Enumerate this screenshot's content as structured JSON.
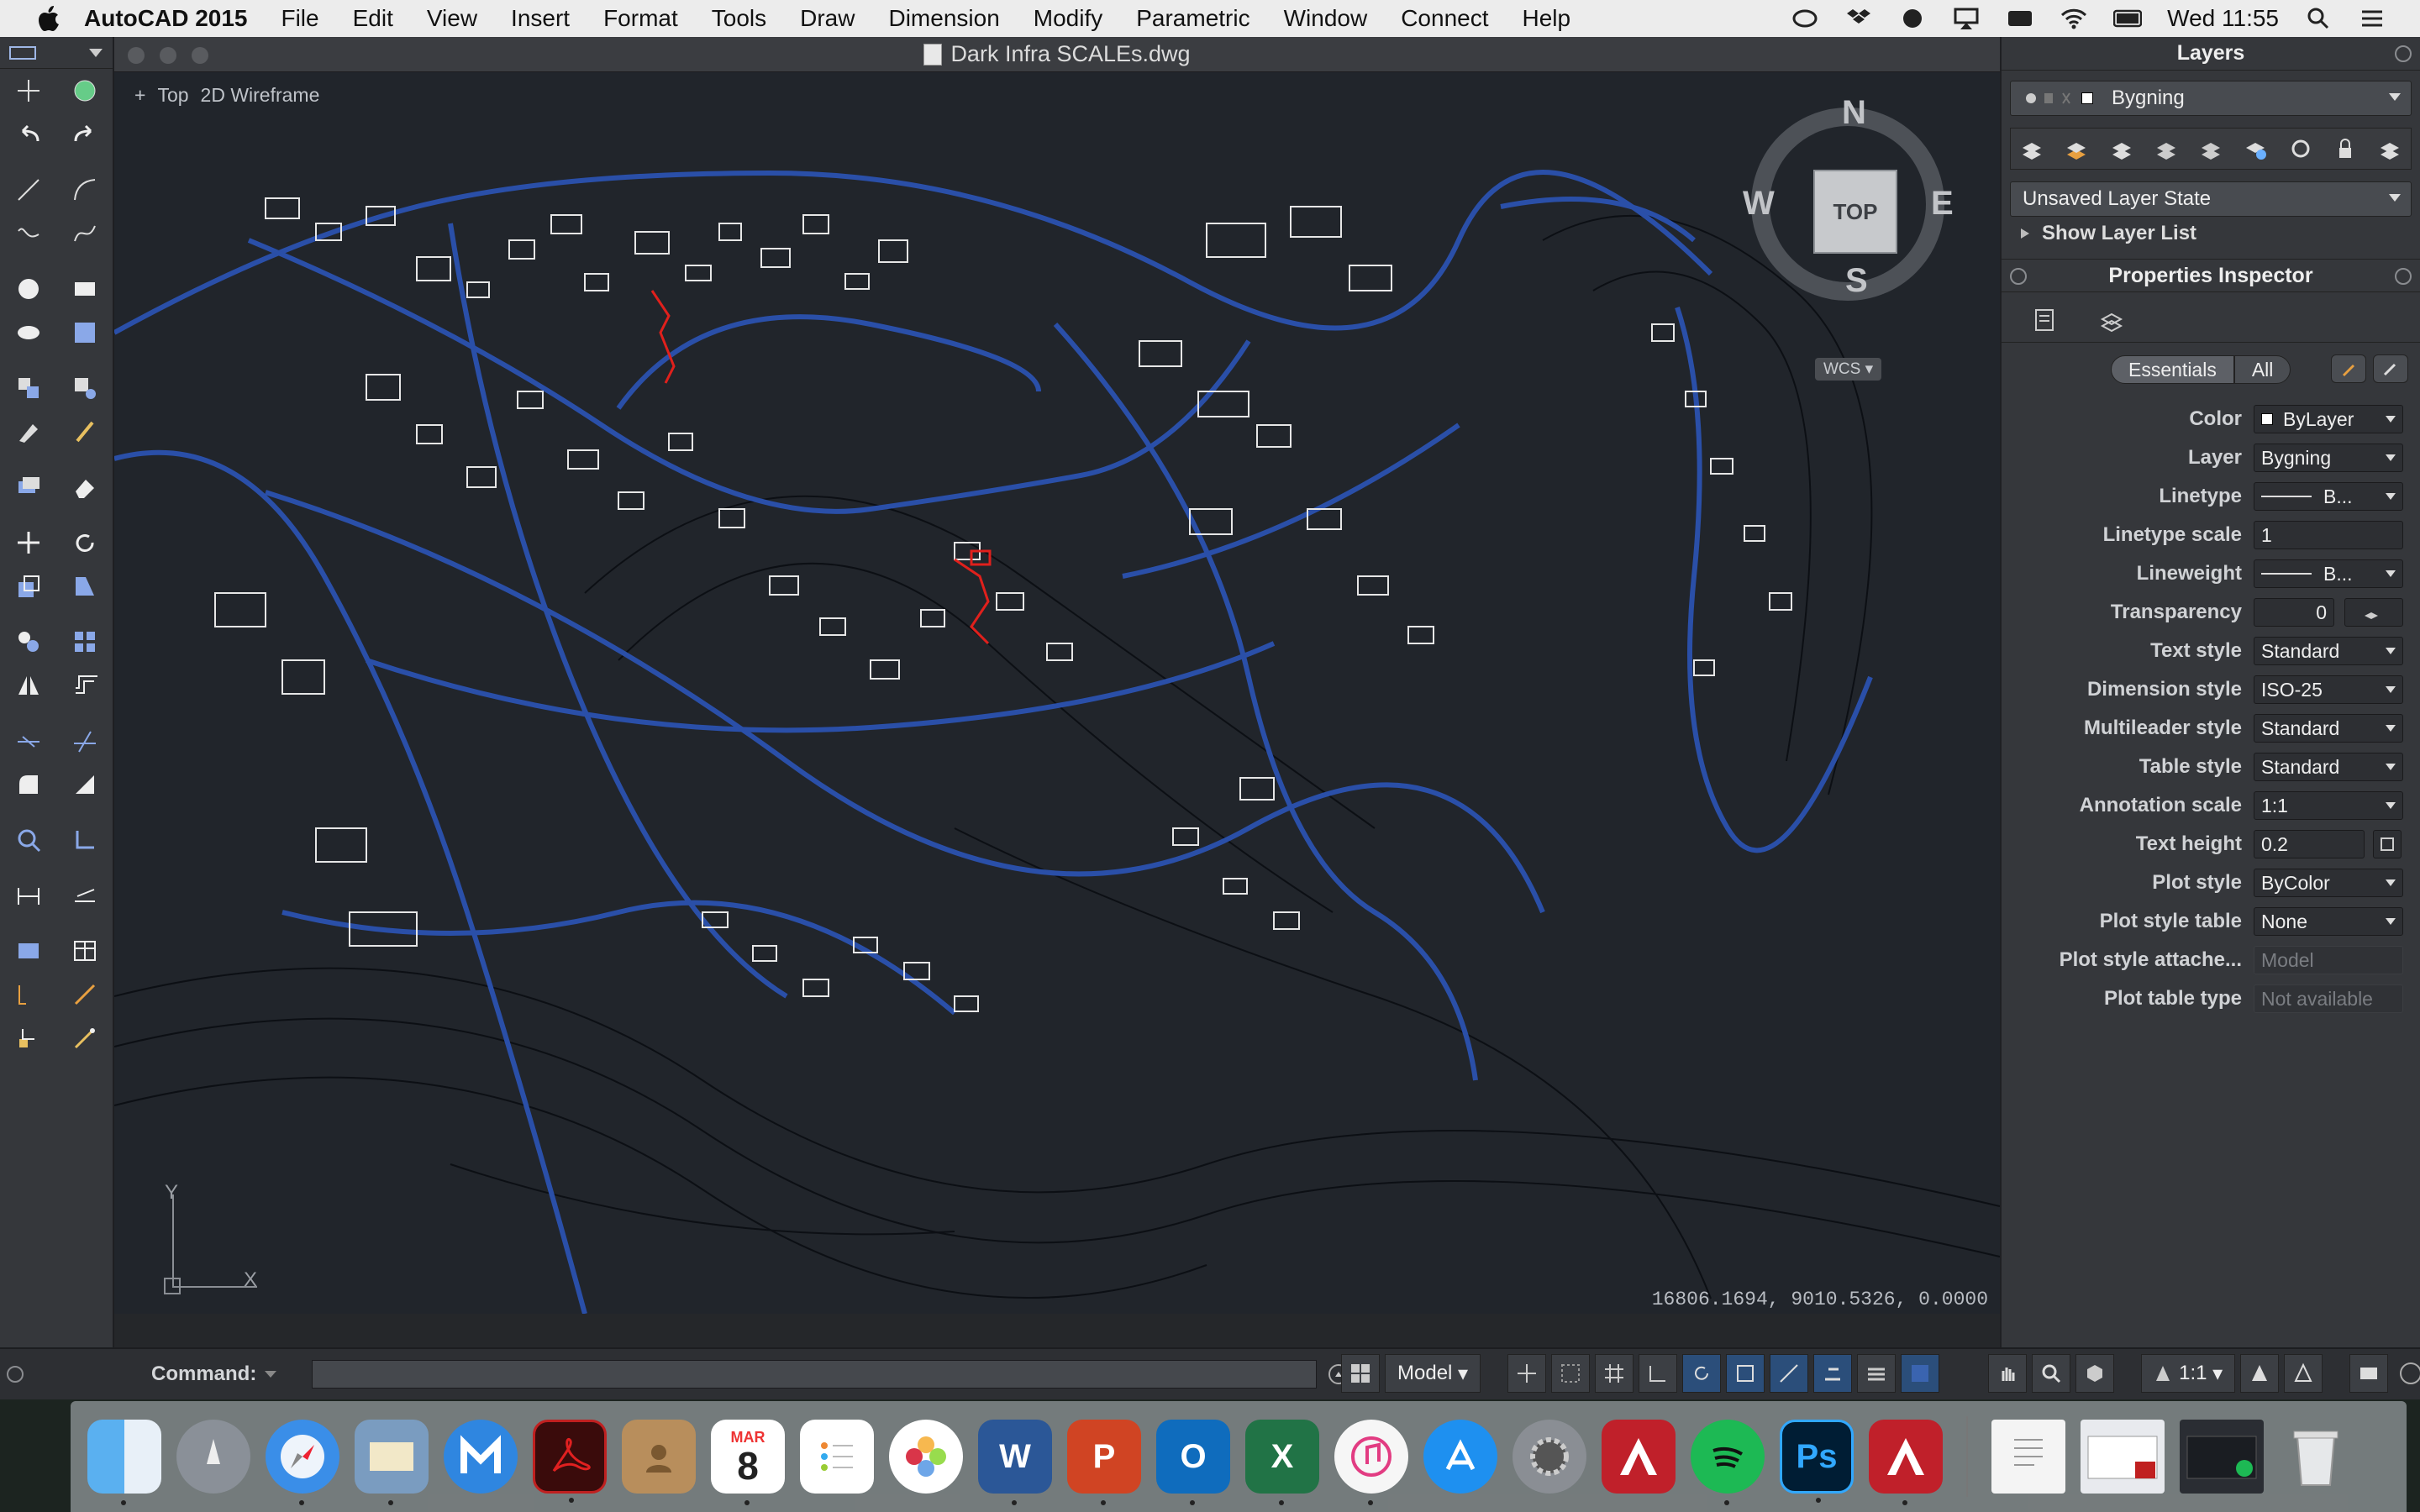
{
  "menubar": {
    "app_name": "AutoCAD 2015",
    "items": [
      "File",
      "Edit",
      "View",
      "Insert",
      "Format",
      "Tools",
      "Draw",
      "Dimension",
      "Modify",
      "Parametric",
      "Window",
      "Connect",
      "Help"
    ],
    "clock": "Wed 11:55"
  },
  "document": {
    "title": "Dark Infra SCALEs.dwg",
    "view_control": {
      "plus": "+",
      "view": "Top",
      "visual_style": "2D Wireframe"
    },
    "coordinates": "16806.1694, 9010.5326, 0.0000",
    "viewcube": {
      "face": "TOP",
      "north": "N",
      "south": "S",
      "east": "E",
      "west": "W",
      "wcs": "WCS"
    },
    "ucs": {
      "x": "X",
      "y": "Y"
    }
  },
  "layers_panel": {
    "title": "Layers",
    "current_layer": "Bygning",
    "layer_state": "Unsaved Layer State",
    "show_layer_list": "Show Layer List"
  },
  "properties_inspector": {
    "title": "Properties Inspector",
    "seg_essentials": "Essentials",
    "seg_all": "All",
    "rows": [
      {
        "label": "Color",
        "value": "ByLayer"
      },
      {
        "label": "Layer",
        "value": "Bygning"
      },
      {
        "label": "Linetype",
        "value": "B..."
      },
      {
        "label": "Linetype scale",
        "value": "1"
      },
      {
        "label": "Lineweight",
        "value": "B..."
      },
      {
        "label": "Transparency",
        "value": "0"
      },
      {
        "label": "Text style",
        "value": "Standard"
      },
      {
        "label": "Dimension style",
        "value": "ISO-25"
      },
      {
        "label": "Multileader style",
        "value": "Standard"
      },
      {
        "label": "Table style",
        "value": "Standard"
      },
      {
        "label": "Annotation scale",
        "value": "1:1"
      },
      {
        "label": "Text height",
        "value": "0.2"
      },
      {
        "label": "Plot style",
        "value": "ByColor"
      },
      {
        "label": "Plot style table",
        "value": "None"
      },
      {
        "label": "Plot style attache...",
        "value": "Model"
      },
      {
        "label": "Plot table type",
        "value": "Not available"
      }
    ]
  },
  "command_line": {
    "label": "Command:"
  },
  "statusbar": {
    "model": "Model",
    "scale": "1:1"
  },
  "dock": {
    "calendar_month": "MAR",
    "calendar_day": "8"
  },
  "colors": {
    "accent": "#2a4fa8",
    "highlight": "#e0201c",
    "background": "#21252b"
  }
}
